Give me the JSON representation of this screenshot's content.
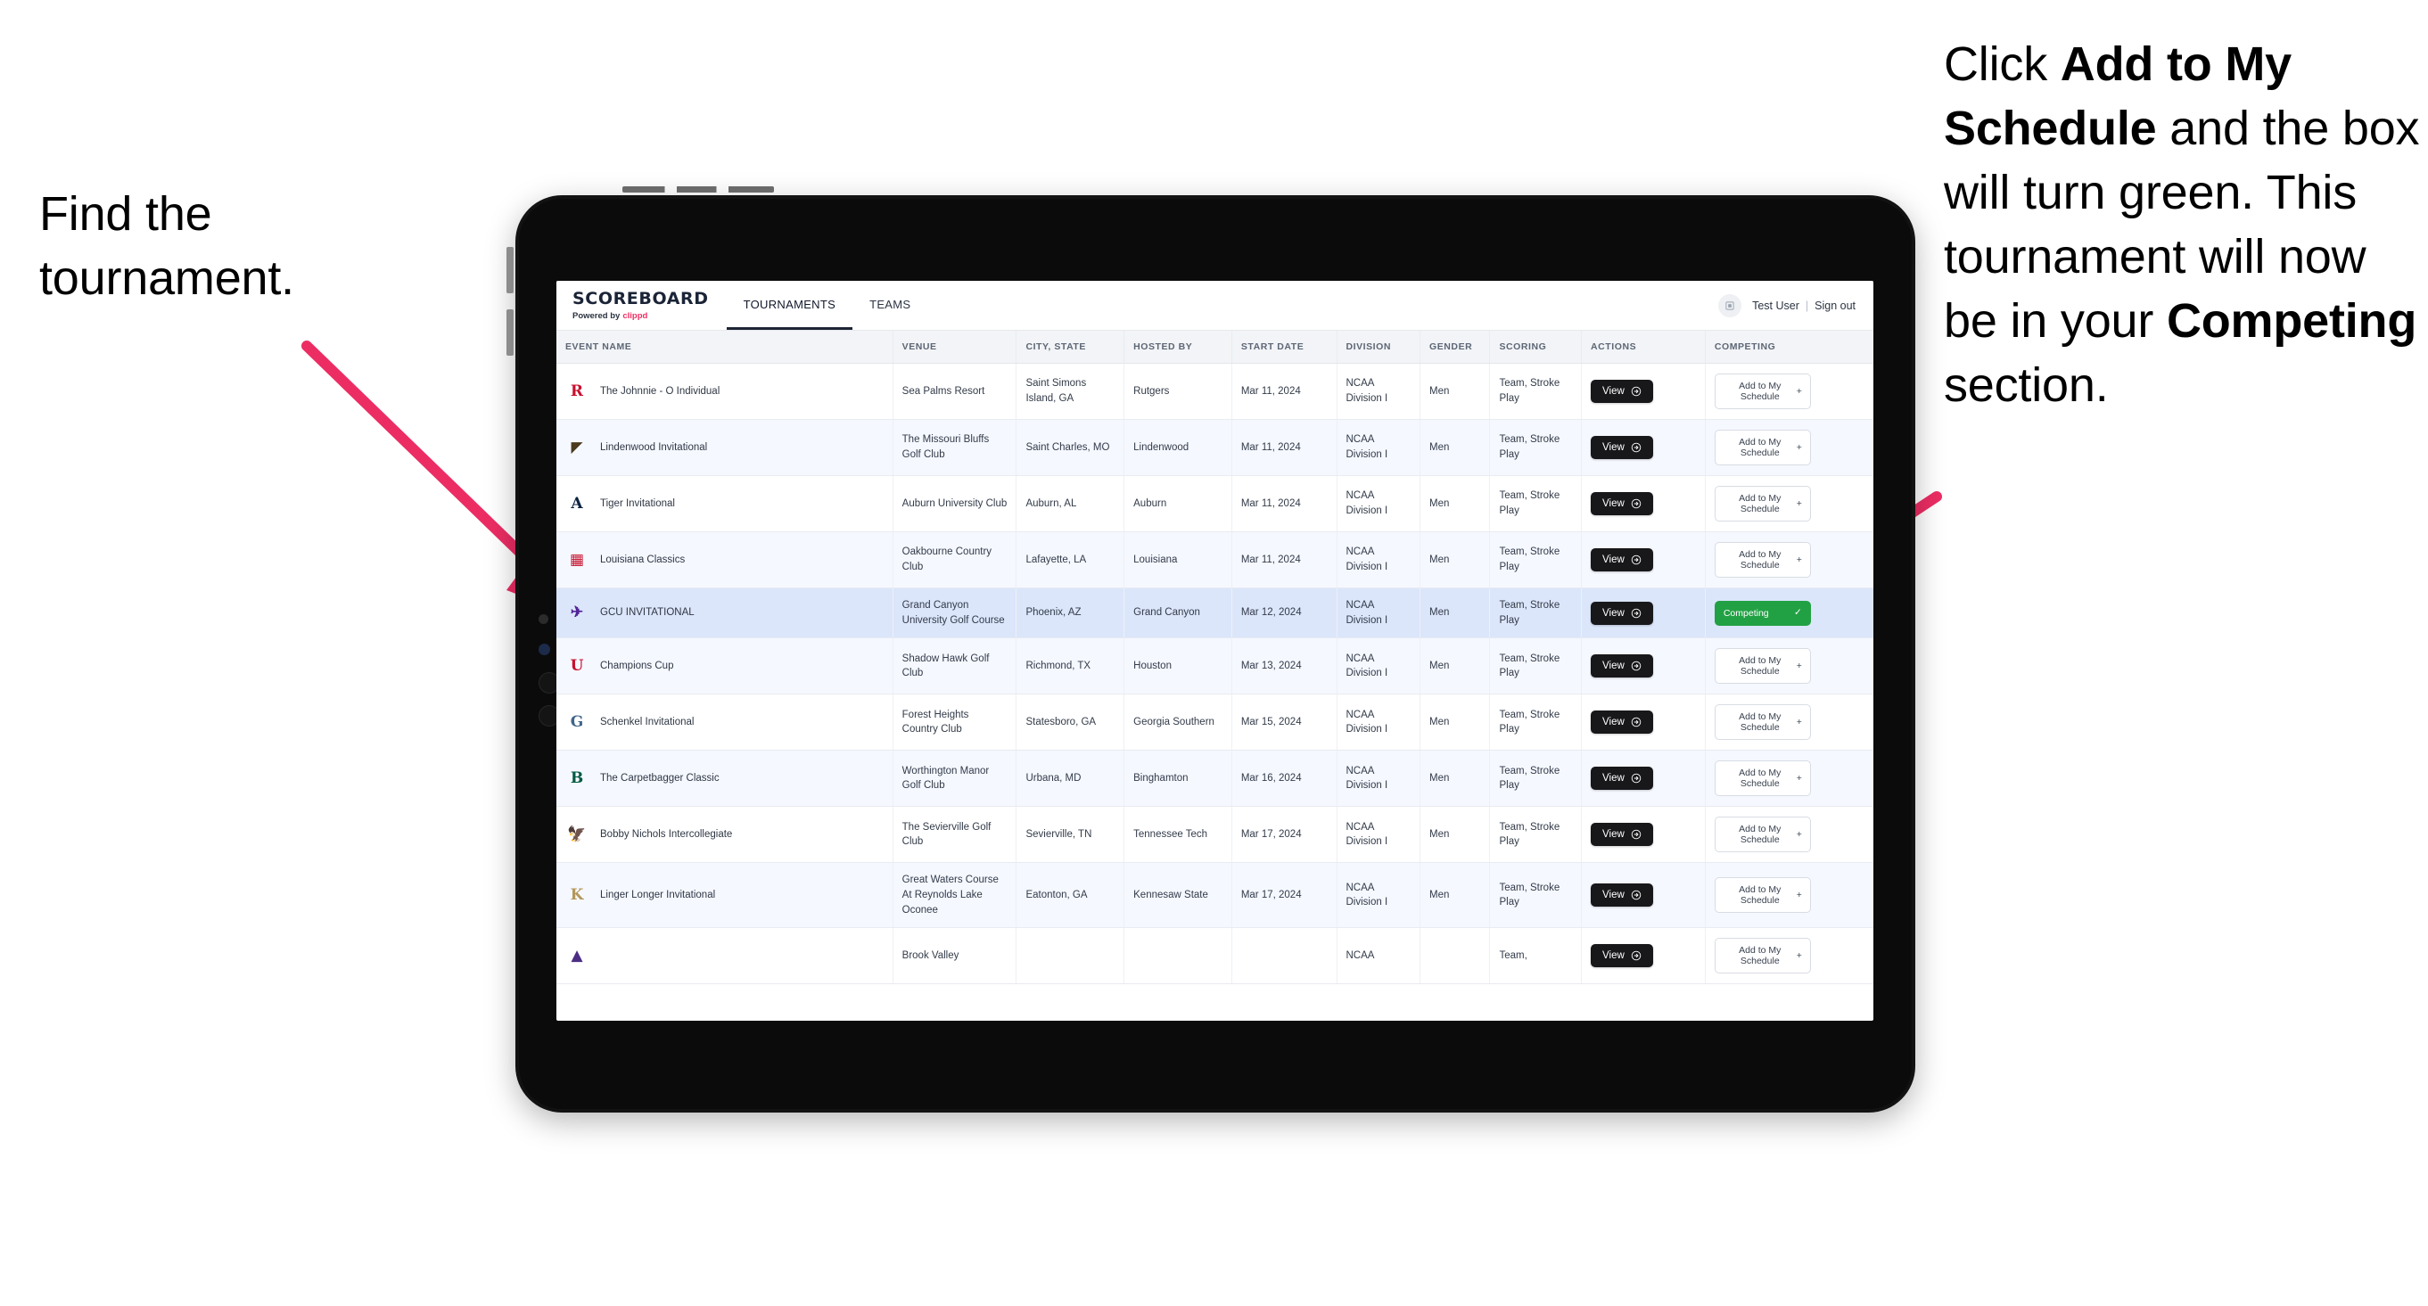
{
  "annotations": {
    "left": {
      "line1": "Find the",
      "line2": "tournament."
    },
    "right": {
      "seg1": "Click ",
      "seg2": "Add to My Schedule",
      "seg3": " and the box will turn green. This tournament will now be in your ",
      "seg4": "Competing",
      "seg5": " section."
    },
    "arrow_color": "#ec2d64"
  },
  "app": {
    "brand": {
      "title": "SCOREBOARD",
      "powered_prefix": "Powered by",
      "powered_brand": "clippd"
    },
    "tabs": [
      {
        "label": "TOURNAMENTS",
        "active": true
      },
      {
        "label": "TEAMS",
        "active": false
      }
    ],
    "header_right": {
      "avatar_icon": "user-avatar-icon",
      "user_name": "Test User",
      "separator": "|",
      "sign_out": "Sign out"
    },
    "table": {
      "columns": [
        "EVENT NAME",
        "VENUE",
        "CITY, STATE",
        "HOSTED BY",
        "START DATE",
        "DIVISION",
        "GENDER",
        "SCORING",
        "ACTIONS",
        "COMPETING"
      ],
      "action_labels": {
        "view": "View",
        "add": "Add to My Schedule",
        "add_icon": "+",
        "competing": "Competing",
        "competing_icon": "✓",
        "view_icon": "→"
      },
      "rows": [
        {
          "logo": "R",
          "logo_color": "#c8102e",
          "logo_name": "rutgers-logo",
          "event": "The Johnnie - O Individual",
          "venue": "Sea Palms Resort",
          "city": "Saint Simons Island, GA",
          "host": "Rutgers",
          "date": "Mar 11, 2024",
          "division": "NCAA Division I",
          "gender": "Men",
          "scoring": "Team, Stroke Play",
          "competing": false
        },
        {
          "logo": "◤",
          "logo_color": "#4a3b1e",
          "logo_name": "lindenwood-logo",
          "event": "Lindenwood Invitational",
          "venue": "The Missouri Bluffs Golf Club",
          "city": "Saint Charles, MO",
          "host": "Lindenwood",
          "date": "Mar 11, 2024",
          "division": "NCAA Division I",
          "gender": "Men",
          "scoring": "Team, Stroke Play",
          "competing": false
        },
        {
          "logo": "A",
          "logo_color": "#0c2340",
          "logo_name": "auburn-logo",
          "event": "Tiger Invitational",
          "venue": "Auburn University Club",
          "city": "Auburn, AL",
          "host": "Auburn",
          "date": "Mar 11, 2024",
          "division": "NCAA Division I",
          "gender": "Men",
          "scoring": "Team, Stroke Play",
          "competing": false
        },
        {
          "logo": "▦",
          "logo_color": "#c8102e",
          "logo_name": "louisiana-ragin-cajuns-logo",
          "event": "Louisiana Classics",
          "venue": "Oakbourne Country Club",
          "city": "Lafayette, LA",
          "host": "Louisiana",
          "date": "Mar 11, 2024",
          "division": "NCAA Division I",
          "gender": "Men",
          "scoring": "Team, Stroke Play",
          "competing": false
        },
        {
          "logo": "✈",
          "logo_color": "#522398",
          "logo_name": "grand-canyon-lopes-logo",
          "event": "GCU INVITATIONAL",
          "venue": "Grand Canyon University Golf Course",
          "city": "Phoenix, AZ",
          "host": "Grand Canyon",
          "date": "Mar 12, 2024",
          "division": "NCAA Division I",
          "gender": "Men",
          "scoring": "Team, Stroke Play",
          "competing": true
        },
        {
          "logo": "U",
          "logo_color": "#c8102e",
          "logo_name": "houston-cougars-logo",
          "event": "Champions Cup",
          "venue": "Shadow Hawk Golf Club",
          "city": "Richmond, TX",
          "host": "Houston",
          "date": "Mar 13, 2024",
          "division": "NCAA Division I",
          "gender": "Men",
          "scoring": "Team, Stroke Play",
          "competing": false
        },
        {
          "logo": "G",
          "logo_color": "#41658a",
          "logo_name": "georgia-southern-eagles-logo",
          "event": "Schenkel Invitational",
          "venue": "Forest Heights Country Club",
          "city": "Statesboro, GA",
          "host": "Georgia Southern",
          "date": "Mar 15, 2024",
          "division": "NCAA Division I",
          "gender": "Men",
          "scoring": "Team, Stroke Play",
          "competing": false
        },
        {
          "logo": "B",
          "logo_color": "#005a43",
          "logo_name": "binghamton-bearcats-logo",
          "event": "The Carpetbagger Classic",
          "venue": "Worthington Manor Golf Club",
          "city": "Urbana, MD",
          "host": "Binghamton",
          "date": "Mar 16, 2024",
          "division": "NCAA Division I",
          "gender": "Men",
          "scoring": "Team, Stroke Play",
          "competing": false
        },
        {
          "logo": "🦅",
          "logo_color": "#5c2d83",
          "logo_name": "tennessee-tech-golden-eagles-logo",
          "event": "Bobby Nichols Intercollegiate",
          "venue": "The Sevierville Golf Club",
          "city": "Sevierville, TN",
          "host": "Tennessee Tech",
          "date": "Mar 17, 2024",
          "division": "NCAA Division I",
          "gender": "Men",
          "scoring": "Team, Stroke Play",
          "competing": false
        },
        {
          "logo": "K",
          "logo_color": "#b49759",
          "logo_name": "kennesaw-state-owls-logo",
          "event": "Linger Longer Invitational",
          "venue": "Great Waters Course At Reynolds Lake Oconee",
          "city": "Eatonton, GA",
          "host": "Kennesaw State",
          "date": "Mar 17, 2024",
          "division": "NCAA Division I",
          "gender": "Men",
          "scoring": "Team, Stroke Play",
          "competing": false
        },
        {
          "logo": "▲",
          "logo_color": "#4b2e83",
          "logo_name": "partial-row-logo",
          "event": "",
          "venue": "Brook Valley",
          "city": "",
          "host": "",
          "date": "",
          "division": "NCAA",
          "gender": "",
          "scoring": "Team,",
          "competing": false
        }
      ]
    }
  }
}
